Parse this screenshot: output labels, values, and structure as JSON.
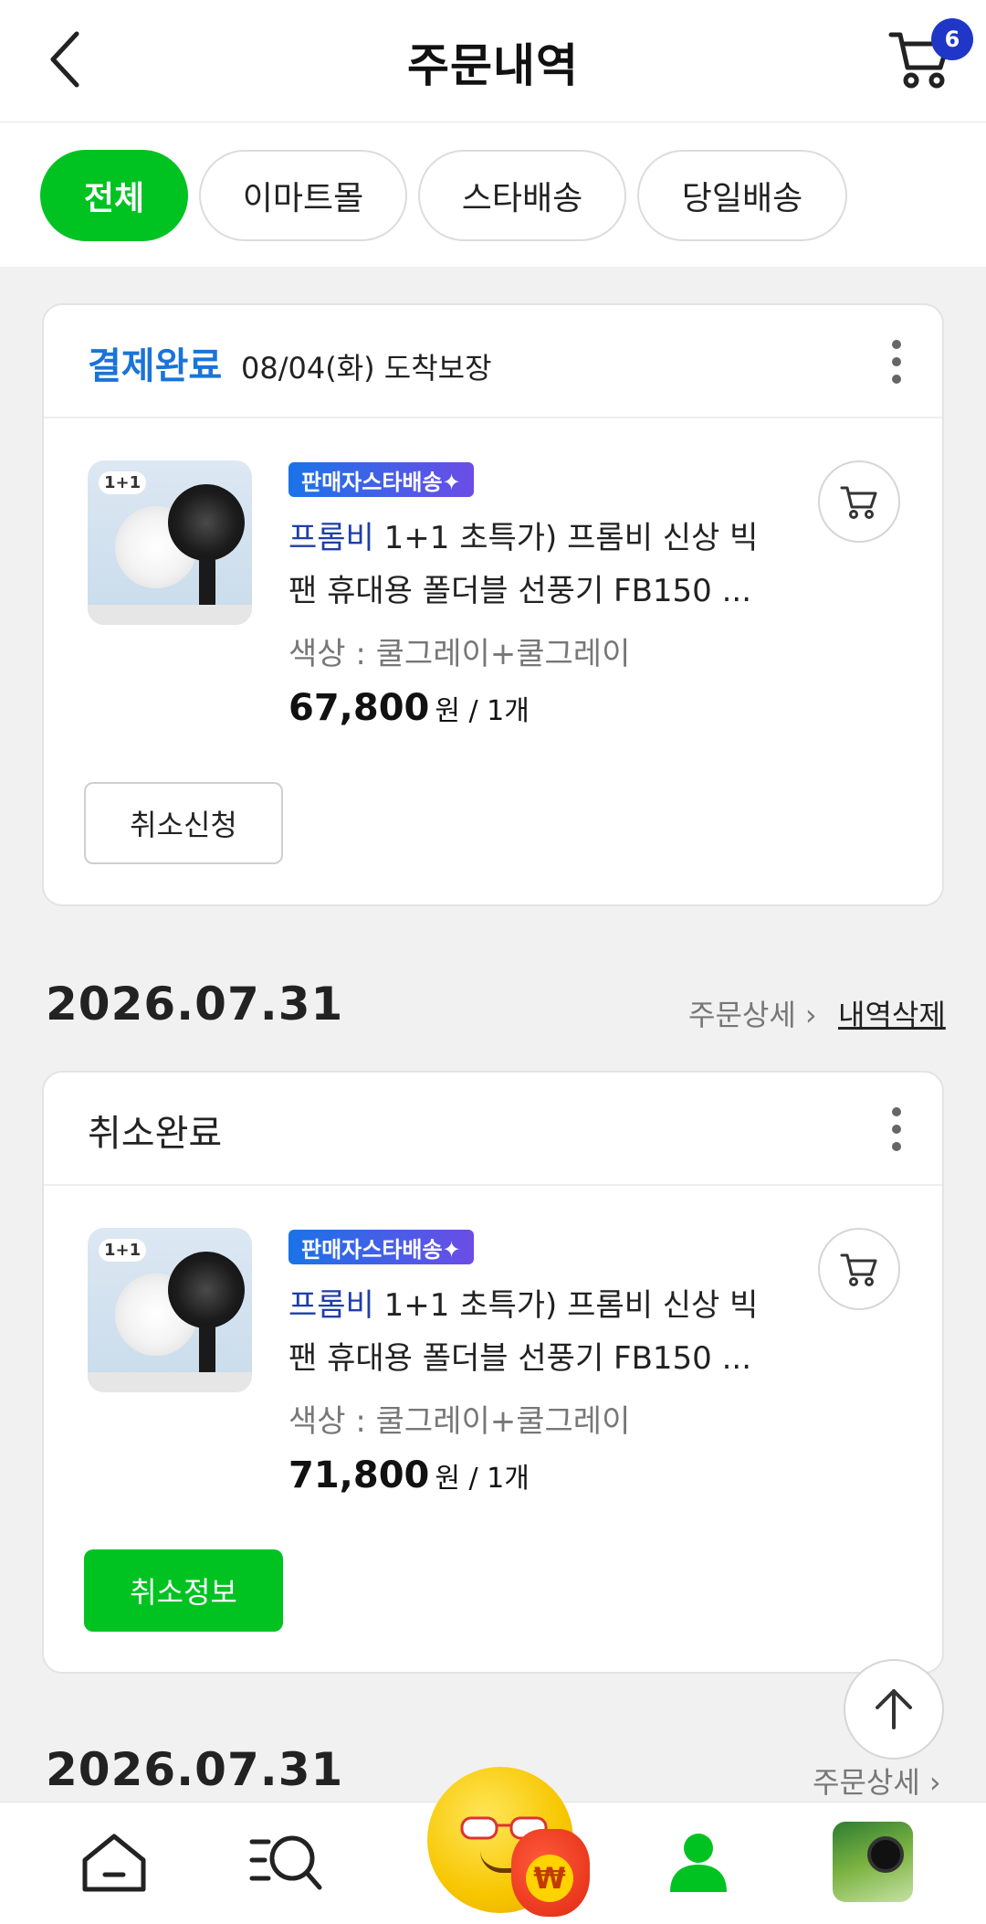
{
  "header": {
    "title": "주문내역",
    "cart_count": "6"
  },
  "filters": {
    "tabs": [
      "전체",
      "이마트몰",
      "스타배송",
      "당일배송"
    ],
    "active": "전체"
  },
  "orders": [
    {
      "status": "결제완료",
      "arrival": "08/04(화) 도착보장",
      "badge": "판매자스타배송✦",
      "brand": "프롬비",
      "name": "1+1 초특가) 프롬비 신상 빅팬 휴대용 폴더블 선풍기 FB150 ...",
      "name_line1": "1+1 초특가) 프롬비 신상 빅",
      "name_line2": "팬 휴대용 폴더블 선풍기 FB150 ...",
      "option": "색상 : 쿨그레이+쿨그레이",
      "price": "67,800",
      "unit": "원 / 1개",
      "action": "취소신청",
      "thumb_label": "1+1"
    },
    {
      "status": "취소완료",
      "date": "2026.07.31",
      "detail_link": "주문상세 ›",
      "delete_link": "내역삭제",
      "badge": "판매자스타배송✦",
      "brand": "프롬비",
      "name_line1": "1+1 초특가) 프롬비 신상 빅",
      "name_line2": "팬 휴대용 폴더블 선풍기 FB150 ...",
      "option": "색상 : 쿨그레이+쿨그레이",
      "price": "71,800",
      "unit": "원 / 1개",
      "action": "취소정보",
      "thumb_label": "1+1"
    }
  ],
  "next_group": {
    "date": "2026.07.31",
    "detail_link": "주문상세 ›"
  },
  "bottom_nav": {
    "items": [
      "home-icon",
      "category-search-icon",
      "event-mascot",
      "my-page-icon",
      "recent-product-thumbnail"
    ],
    "mascot_symbol": "₩"
  },
  "colors": {
    "accent_green": "#00c322",
    "status_blue": "#1a73d8",
    "brand_blue": "#1f3ea8",
    "badge_blue": "#1f36c7"
  }
}
